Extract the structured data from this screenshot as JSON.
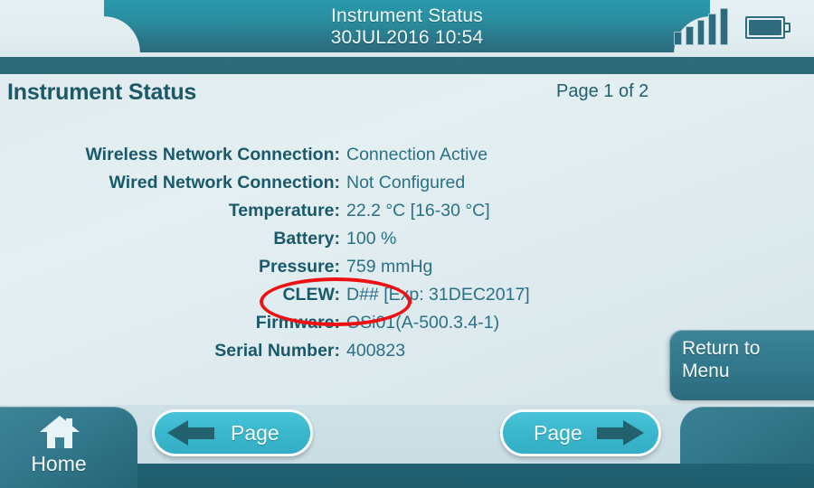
{
  "titlebar": {
    "title": "Instrument Status",
    "datetime": "30JUL2016 10:54",
    "signal_icon": "signal-bars-icon",
    "signal_bars": 5,
    "battery_icon": "battery-full-icon",
    "battery_level": 100
  },
  "header": {
    "page_title": "Instrument Status",
    "page_indicator": "Page 1 of 2"
  },
  "status": {
    "rows": [
      {
        "label": "Wireless Network Connection:",
        "value": "Connection Active"
      },
      {
        "label": "Wired Network Connection:",
        "value": "Not Configured"
      },
      {
        "label": "Temperature:",
        "value": "22.2 °C [16-30 °C]"
      },
      {
        "label": "Battery:",
        "value": "100 %"
      },
      {
        "label": "Pressure:",
        "value": "759 mmHg"
      },
      {
        "label": "CLEW:",
        "value": "D## [Exp: 31DEC2017]"
      },
      {
        "label": "Firmware:",
        "value": "OSi01(A-500.3.4-1)"
      },
      {
        "label": "Serial Number:",
        "value": "400823"
      }
    ]
  },
  "annotation": {
    "shape": "ellipse",
    "color": "#ee1111",
    "target_row_label": "CLEW:",
    "target_text": "CLEW: D##"
  },
  "actions": {
    "return_to_menu_line1": "Return to",
    "return_to_menu_line2": "Menu",
    "home_label": "Home",
    "home_icon": "house-icon",
    "prev_page_label": "Page",
    "prev_page_icon": "arrow-left-icon",
    "next_page_label": "Page",
    "next_page_icon": "arrow-right-icon"
  },
  "colors": {
    "accent_teal": "#2a8d9f",
    "dark_teal": "#1c5868",
    "value_teal": "#2a7086",
    "button_cyan": "#3cb8ce",
    "panel_teal": "#33788c",
    "background": "#e0ebee",
    "annotation_red": "#ee1111"
  }
}
